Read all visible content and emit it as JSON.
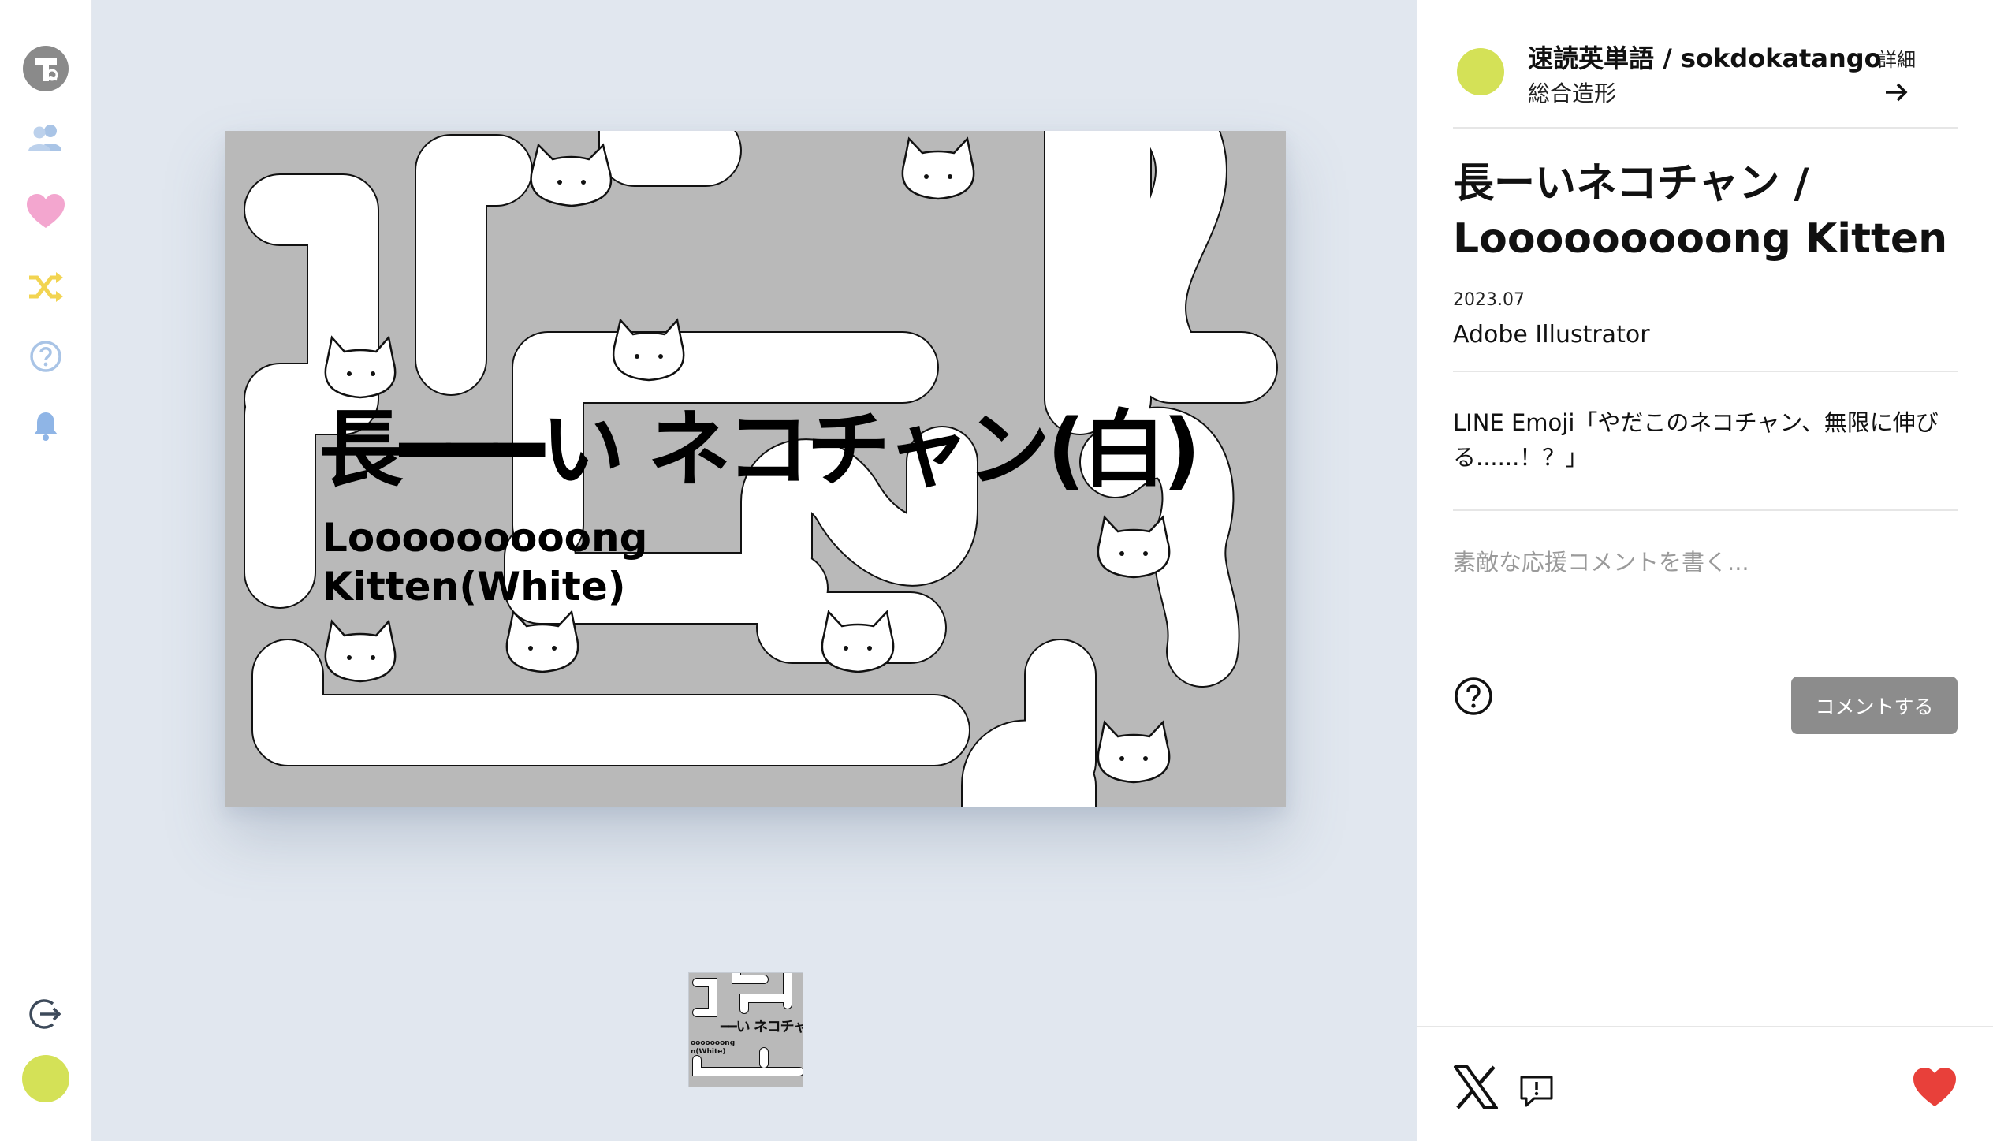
{
  "sidebar": {
    "logo_letter": "T",
    "icons": [
      "logo-icon",
      "users-icon",
      "heart-icon",
      "shuffle-icon",
      "help-icon",
      "bell-icon",
      "logout-icon",
      "avatar"
    ],
    "colors": {
      "users": "#a9c4e6",
      "heart": "#f3a6cf",
      "shuffle": "#f2d451",
      "help": "#a9c4e6",
      "bell": "#8fb5e6",
      "logout": "#3d4a5a",
      "avatar": "#d4e157",
      "logo": "#8a8a8a"
    }
  },
  "artwork": {
    "title_jp": "長━━━い ネコチャン(白)",
    "title_en_line1": "Looooooooong",
    "title_en_line2": "Kitten(White)",
    "background_color": "#b9b9b9"
  },
  "thumbnail": {
    "title_jp": "━━い ネコチャン(",
    "title_en_line1": "ooooooong",
    "title_en_line2": "n(White)"
  },
  "author": {
    "name": "速読英単語 / sokdokatango",
    "category": "総合造形",
    "detail_label": "詳細",
    "avatar_color": "#d4e157"
  },
  "work": {
    "title": "長ーいネコチャン / Looooooooong Kitten",
    "date": "2023.07",
    "tool": "Adobe Illustrator",
    "description": "LINE Emoji「やだこのネコチャン、無限に伸びる......！？」"
  },
  "comment": {
    "placeholder": "素敵な応援コメントを書く...",
    "value": "",
    "submit_label": "コメントする"
  },
  "footer": {
    "icons": [
      "x-icon",
      "feedback-icon",
      "like-heart-icon"
    ],
    "like_color": "#e8403a"
  }
}
